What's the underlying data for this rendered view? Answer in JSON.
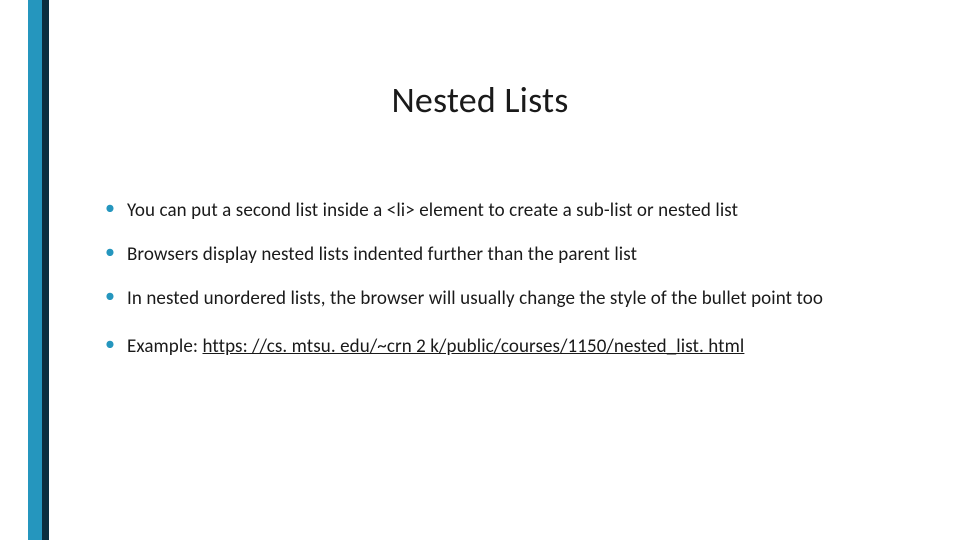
{
  "slide": {
    "title": "Nested Lists",
    "bullets": [
      {
        "text": "You can put a second list inside a <li> element to create a sub-list or nested list"
      },
      {
        "text": "Browsers display nested lists indented further than the parent list"
      },
      {
        "text": "In nested unordered lists, the browser will usually change the style of the bullet point too"
      },
      {
        "prefix": "Example: ",
        "link": "https: //cs. mtsu. edu/~crn 2 k/public/courses/1150/nested_list. html"
      }
    ]
  },
  "accent_color": "#2596be"
}
